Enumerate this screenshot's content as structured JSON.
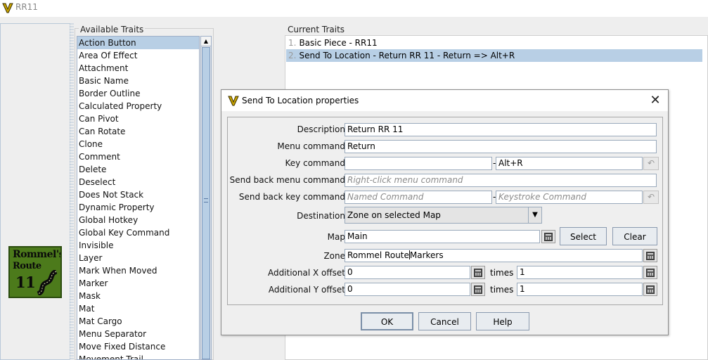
{
  "window": {
    "title": "RR11",
    "icon": "vassal-logo-icon"
  },
  "piece_image": {
    "line1": "Rommel's",
    "line2": "Route",
    "line3": "11"
  },
  "available_traits": {
    "title": "Available Traits",
    "items": [
      "Action Button",
      "Area Of Effect",
      "Attachment",
      "Basic Name",
      "Border Outline",
      "Calculated Property",
      "Can Pivot",
      "Can Rotate",
      "Clone",
      "Comment",
      "Delete",
      "Deselect",
      "Does Not Stack",
      "Dynamic Property",
      "Global Hotkey",
      "Global Key Command",
      "Invisible",
      "Layer",
      "Mark When Moved",
      "Marker",
      "Mask",
      "Mat",
      "Mat Cargo",
      "Menu Separator",
      "Move Fixed Distance",
      "Movement Trail"
    ],
    "selected_index": 0
  },
  "current_traits": {
    "title": "Current Traits",
    "items": [
      {
        "num": "1.",
        "label": "Basic Piece - RR11"
      },
      {
        "num": "2.",
        "label": "Send To Location - Return RR 11 - Return => Alt+R"
      }
    ],
    "selected_index": 1
  },
  "dialog": {
    "title": "Send To Location properties",
    "fields": {
      "description": {
        "label": "Description",
        "value": "Return RR 11"
      },
      "menu_command": {
        "label": "Menu command",
        "value": "Return"
      },
      "key_command": {
        "label": "Key command",
        "named_value": "",
        "dash": "-",
        "keystroke_value": "Alt+R"
      },
      "send_back_menu": {
        "label": "Send back menu command",
        "placeholder": "Right-click menu command"
      },
      "send_back_key": {
        "label": "Send back key command",
        "named_placeholder": "Named Command",
        "dash": "-",
        "keystroke_placeholder": "Keystroke Command"
      },
      "destination": {
        "label": "Destination",
        "value": "Zone on selected Map"
      },
      "map": {
        "label": "Map",
        "value": "Main",
        "select_label": "Select",
        "clear_label": "Clear"
      },
      "zone": {
        "label": "Zone",
        "value_before_caret": "Rommel Route",
        "value_after_caret": "Markers"
      },
      "x_offset": {
        "label": "Additional X offset",
        "value": "0",
        "times_label": "times",
        "multiplier": "1"
      },
      "y_offset": {
        "label": "Additional Y offset",
        "value": "0",
        "times_label": "times",
        "multiplier": "1"
      }
    },
    "buttons": {
      "ok": "OK",
      "cancel": "Cancel",
      "help": "Help"
    }
  },
  "colors": {
    "selection": "#b8cfe5",
    "piece_background": "#4c7a1b"
  }
}
